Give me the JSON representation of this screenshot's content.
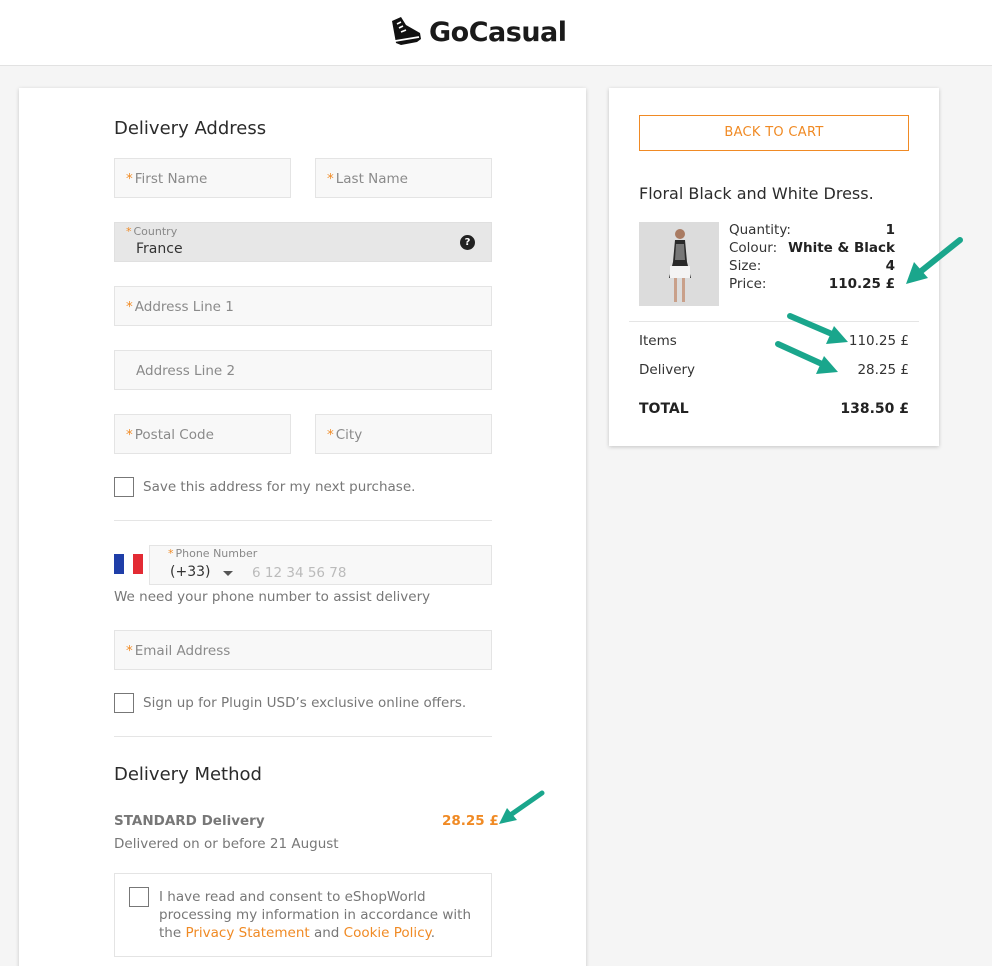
{
  "brand": {
    "name": "GoCasual",
    "logo_icon": "sneaker-icon"
  },
  "delivery_address": {
    "title": "Delivery Address",
    "first_name_placeholder": "First Name",
    "last_name_placeholder": "Last Name",
    "country_label": "Country",
    "country_value": "France",
    "address1_placeholder": "Address Line 1",
    "address2_placeholder": "Address Line 2",
    "postal_placeholder": "Postal Code",
    "city_placeholder": "City",
    "required_mark": "*",
    "save_address_label": "Save this address for my next purchase."
  },
  "phone": {
    "label": "Phone Number",
    "country_code": "(+33)",
    "placeholder": "6 12 34 56 78",
    "note": "We need your phone number to assist delivery",
    "flag": "france-flag"
  },
  "email": {
    "placeholder": "Email Address",
    "signup_label": "Sign up for Plugin USD’s exclusive online offers."
  },
  "delivery_method": {
    "title": "Delivery Method",
    "option_name": "STANDARD Delivery",
    "option_price": "28.25 £",
    "option_note": "Delivered on or before 21 August"
  },
  "consent": {
    "text_before": "I have read and consent to eShopWorld processing my information in accordance with the ",
    "privacy_link": "Privacy Statement",
    "and_text": " and ",
    "cookie_link": "Cookie Policy",
    "period": "."
  },
  "cart": {
    "back_button": "BACK TO CART",
    "product_title": "Floral Black and White Dress.",
    "attributes": [
      {
        "label": "Quantity:",
        "value": "1"
      },
      {
        "label": "Colour:",
        "value": "White & Black"
      },
      {
        "label": "Size:",
        "value": "4"
      },
      {
        "label": "Price:",
        "value": "110.25 £"
      }
    ],
    "items_label": "Items",
    "items_value": "110.25 £",
    "delivery_label": "Delivery",
    "delivery_value": "28.25 £",
    "total_label": "TOTAL",
    "total_value": "138.50 £"
  },
  "colors": {
    "accent": "#f08a24",
    "annotation_arrow": "#1aa68c"
  }
}
